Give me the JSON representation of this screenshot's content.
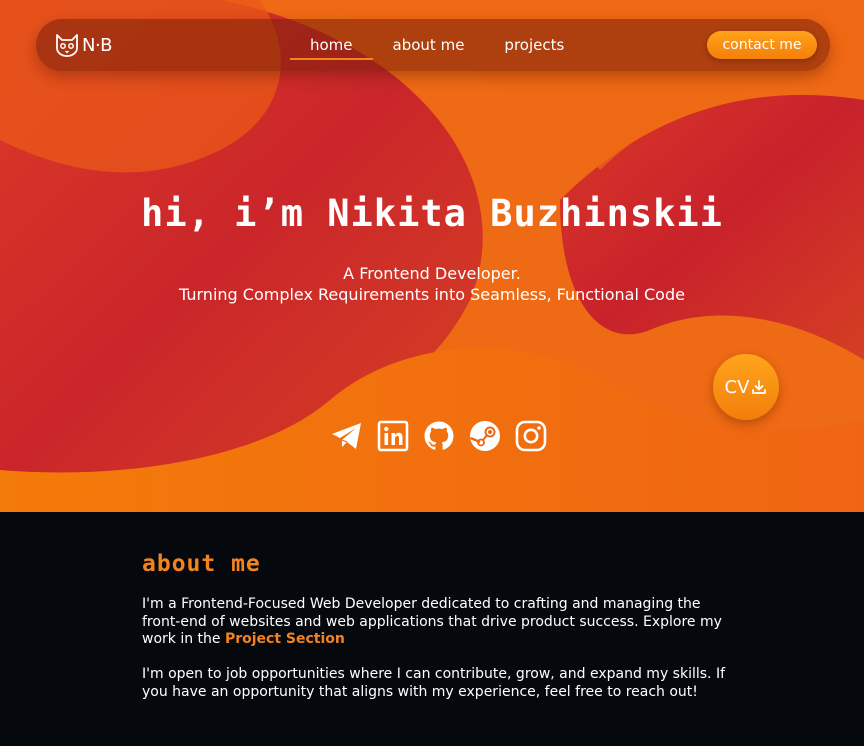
{
  "nav": {
    "logo_text": "N·B",
    "links": [
      {
        "label": "home",
        "active": true
      },
      {
        "label": "about me",
        "active": false
      },
      {
        "label": "projects",
        "active": false
      }
    ],
    "contact_label": "contact me"
  },
  "hero": {
    "title": "hi, i’m Nikita Buzhinskii",
    "subtitle_line1": "A Frontend Developer.",
    "subtitle_line2": "Turning Complex Requirements into Seamless, Functional Code",
    "cv_label": "CV"
  },
  "socials": [
    {
      "icon": "telegram-icon"
    },
    {
      "icon": "linkedin-icon"
    },
    {
      "icon": "github-icon"
    },
    {
      "icon": "steam-icon"
    },
    {
      "icon": "instagram-icon"
    }
  ],
  "about": {
    "title": "about me",
    "para1_before": "I'm a Frontend-Focused Web Developer dedicated to crafting and managing the front-end  of websites and web applications that drive product success. Explore my work in the ",
    "para1_link": "Project Section",
    "para2": "I'm open to job opportunities where I can contribute, grow, and expand my skills. If you have an opportunity that aligns with my experience, feel free to reach out!"
  },
  "colors": {
    "accent": "#f4831f",
    "hero_orange": "#f06a12",
    "hero_red": "#c41a2e",
    "dark_bg": "#05090d"
  }
}
